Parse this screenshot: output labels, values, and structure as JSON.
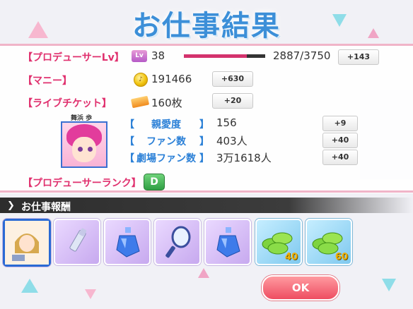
{
  "header": {
    "title": "お仕事結果"
  },
  "producer_lv": {
    "label": "【プロデューサーLv】",
    "icon": "Lv",
    "level": "38",
    "exp": "2887/3750",
    "exp_fraction": 0.77,
    "gain": "+143"
  },
  "money": {
    "label": "【マニー】",
    "icon": "coin-icon",
    "value": "191466",
    "gain": "+630"
  },
  "tickets": {
    "label": "【ライブチケット】",
    "icon": "ticket-icon",
    "value": "160枚",
    "gain": "+20"
  },
  "idol": {
    "name": "舞浜 歩",
    "stats": [
      {
        "open": "【",
        "label": "親愛度",
        "close": "】",
        "value": "156",
        "gain": "+9"
      },
      {
        "open": "【",
        "label": "ファン数",
        "close": "】",
        "value": "403人",
        "gain": "+40"
      },
      {
        "open": "【",
        "label": "劇場ファン数",
        "close": "】",
        "value": "3万1618人",
        "gain": "+40"
      }
    ]
  },
  "producer_rank": {
    "label": "【プロデューサーランク】",
    "rank": "D"
  },
  "rewards": {
    "title": "お仕事報酬",
    "items": [
      {
        "name": "idol-card",
        "qty": ""
      },
      {
        "name": "lipstick",
        "qty": ""
      },
      {
        "name": "perfume-bottle",
        "qty": ""
      },
      {
        "name": "hand-mirror",
        "qty": ""
      },
      {
        "name": "perfume-bottle",
        "qty": ""
      },
      {
        "name": "green-macarons",
        "qty": "40"
      },
      {
        "name": "green-macarons",
        "qty": "60"
      }
    ]
  },
  "ok_button": {
    "label": "OK"
  },
  "colors": {
    "accent_pink": "#e0306e",
    "accent_blue": "#2b80d7",
    "ok_button": "#ee4d61"
  }
}
